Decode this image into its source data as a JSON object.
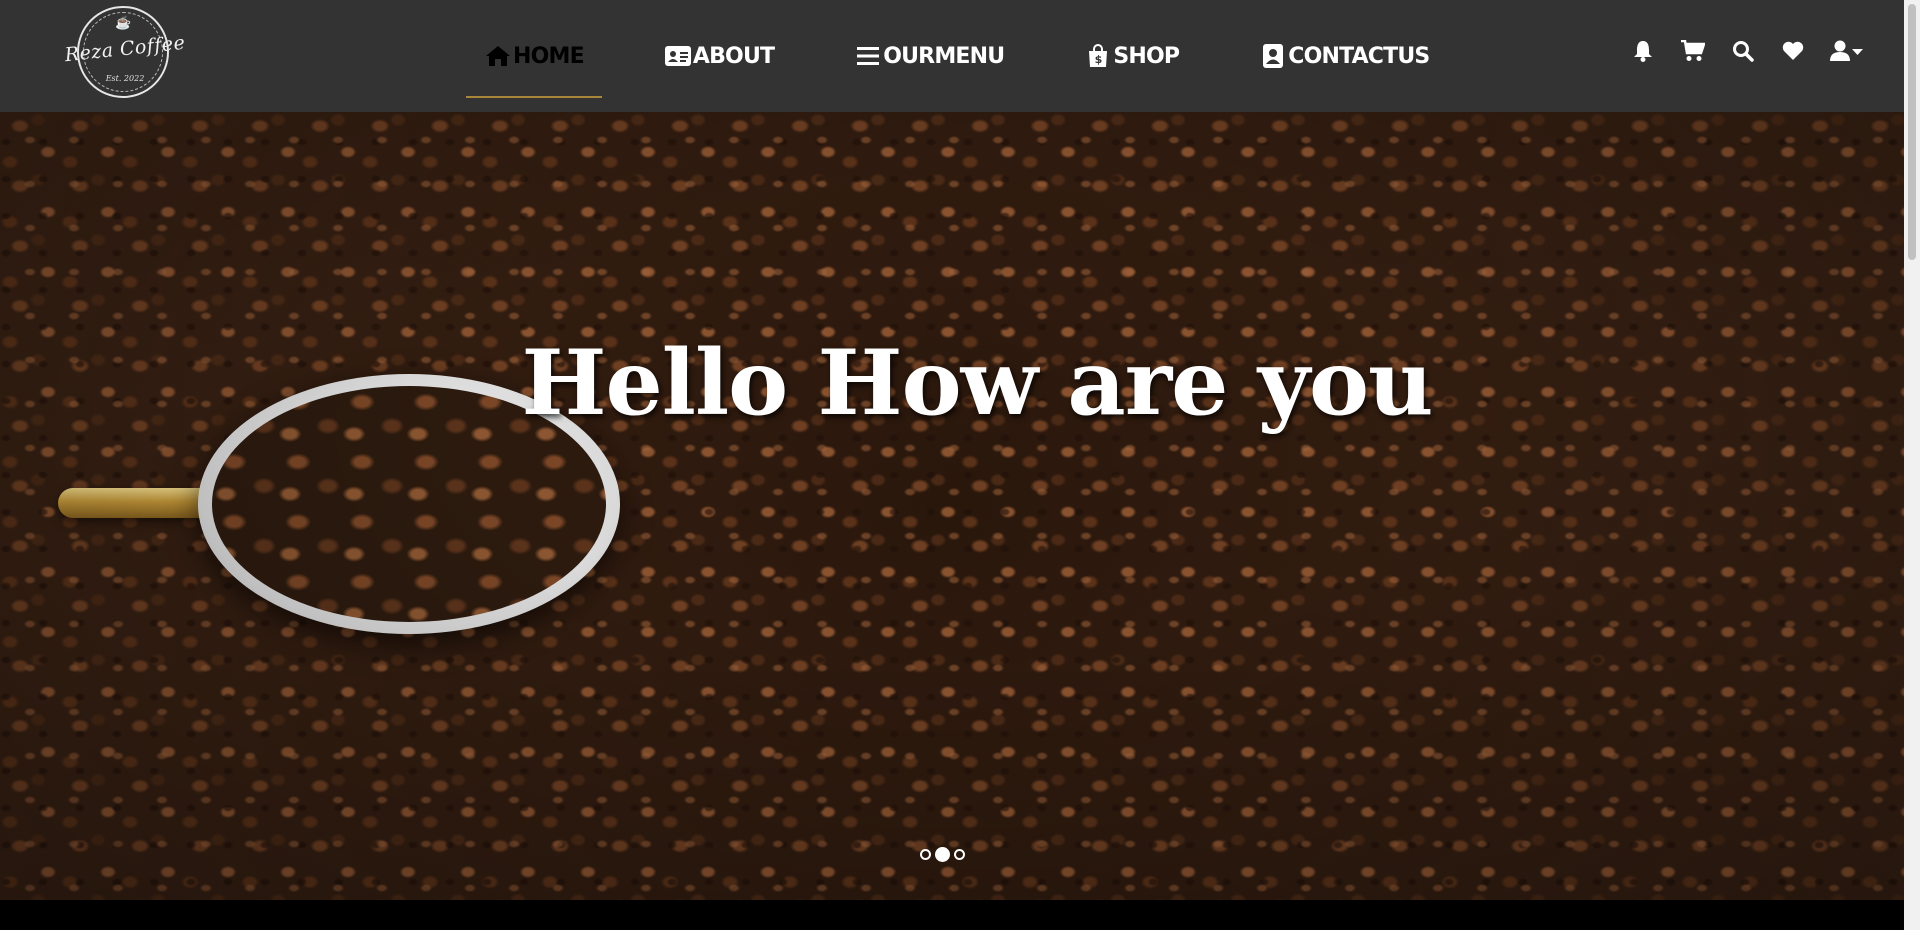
{
  "brand": {
    "name": "Reza Coffee",
    "established": "Est. 2022"
  },
  "nav": {
    "links": [
      {
        "label": "HOME",
        "icon": "home-icon",
        "active": true
      },
      {
        "label": "ABOUT",
        "icon": "id-card-icon",
        "active": false
      },
      {
        "label": "OURMENU",
        "icon": "menu-icon",
        "active": false
      },
      {
        "label": "SHOP",
        "icon": "shopping-bag-icon",
        "active": false
      },
      {
        "label": "CONTACTUS",
        "icon": "contact-icon",
        "active": false
      }
    ],
    "actions": [
      "bell-icon",
      "cart-icon",
      "search-icon",
      "heart-icon",
      "user-dropdown-icon"
    ],
    "active_underline_color": "#a8863a",
    "background_color": "#333333"
  },
  "hero": {
    "title": "Hello How are you",
    "slides_total": 3,
    "active_slide": 2
  }
}
